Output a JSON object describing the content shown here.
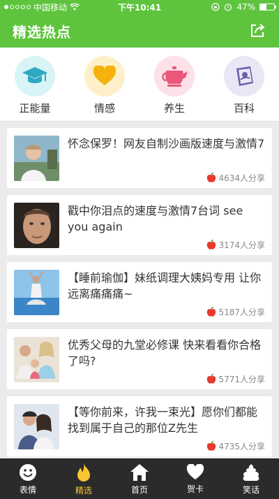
{
  "status": {
    "carrier": "中国移动",
    "time": "下午10:41",
    "battery": "47%",
    "battery_level": 0.47
  },
  "header": {
    "title": "精选热点"
  },
  "categories": [
    {
      "label": "正能量",
      "icon": "graduation-cap-icon",
      "bg": "#d8f4f6"
    },
    {
      "label": "情感",
      "icon": "heart-icon",
      "bg": "#fdf0c8"
    },
    {
      "label": "养生",
      "icon": "teapot-icon",
      "bg": "#fde0e8"
    },
    {
      "label": "百科",
      "icon": "book-icon",
      "bg": "#e9e6f6"
    }
  ],
  "feed": [
    {
      "title": "怀念保罗！网友自制沙画版速度与激情7",
      "shares": "4634人分享"
    },
    {
      "title": "戳中你泪点的速度与激情7台词 see you again",
      "shares": "3174人分享"
    },
    {
      "title": "【睡前瑜伽】妹纸调理大姨妈专用 让你远离痛痛痛~",
      "shares": "5187人分享"
    },
    {
      "title": "优秀父母的九堂必修课 快来看看你合格了吗?",
      "shares": "5771人分享"
    },
    {
      "title": "【等你前来，许我一束光】愿你们都能找到属于自己的那位Z先生",
      "shares": "4735人分享"
    }
  ],
  "tabs": [
    {
      "label": "表情",
      "icon": "smiley-icon"
    },
    {
      "label": "精选",
      "icon": "flame-icon"
    },
    {
      "label": "首页",
      "icon": "home-icon"
    },
    {
      "label": "贺卡",
      "icon": "heart-icon"
    },
    {
      "label": "笑话",
      "icon": "poop-icon"
    }
  ],
  "colors": {
    "brand": "#5ec43d",
    "tab_active": "#f7c531",
    "tabbar_bg": "#2b2b2b"
  }
}
